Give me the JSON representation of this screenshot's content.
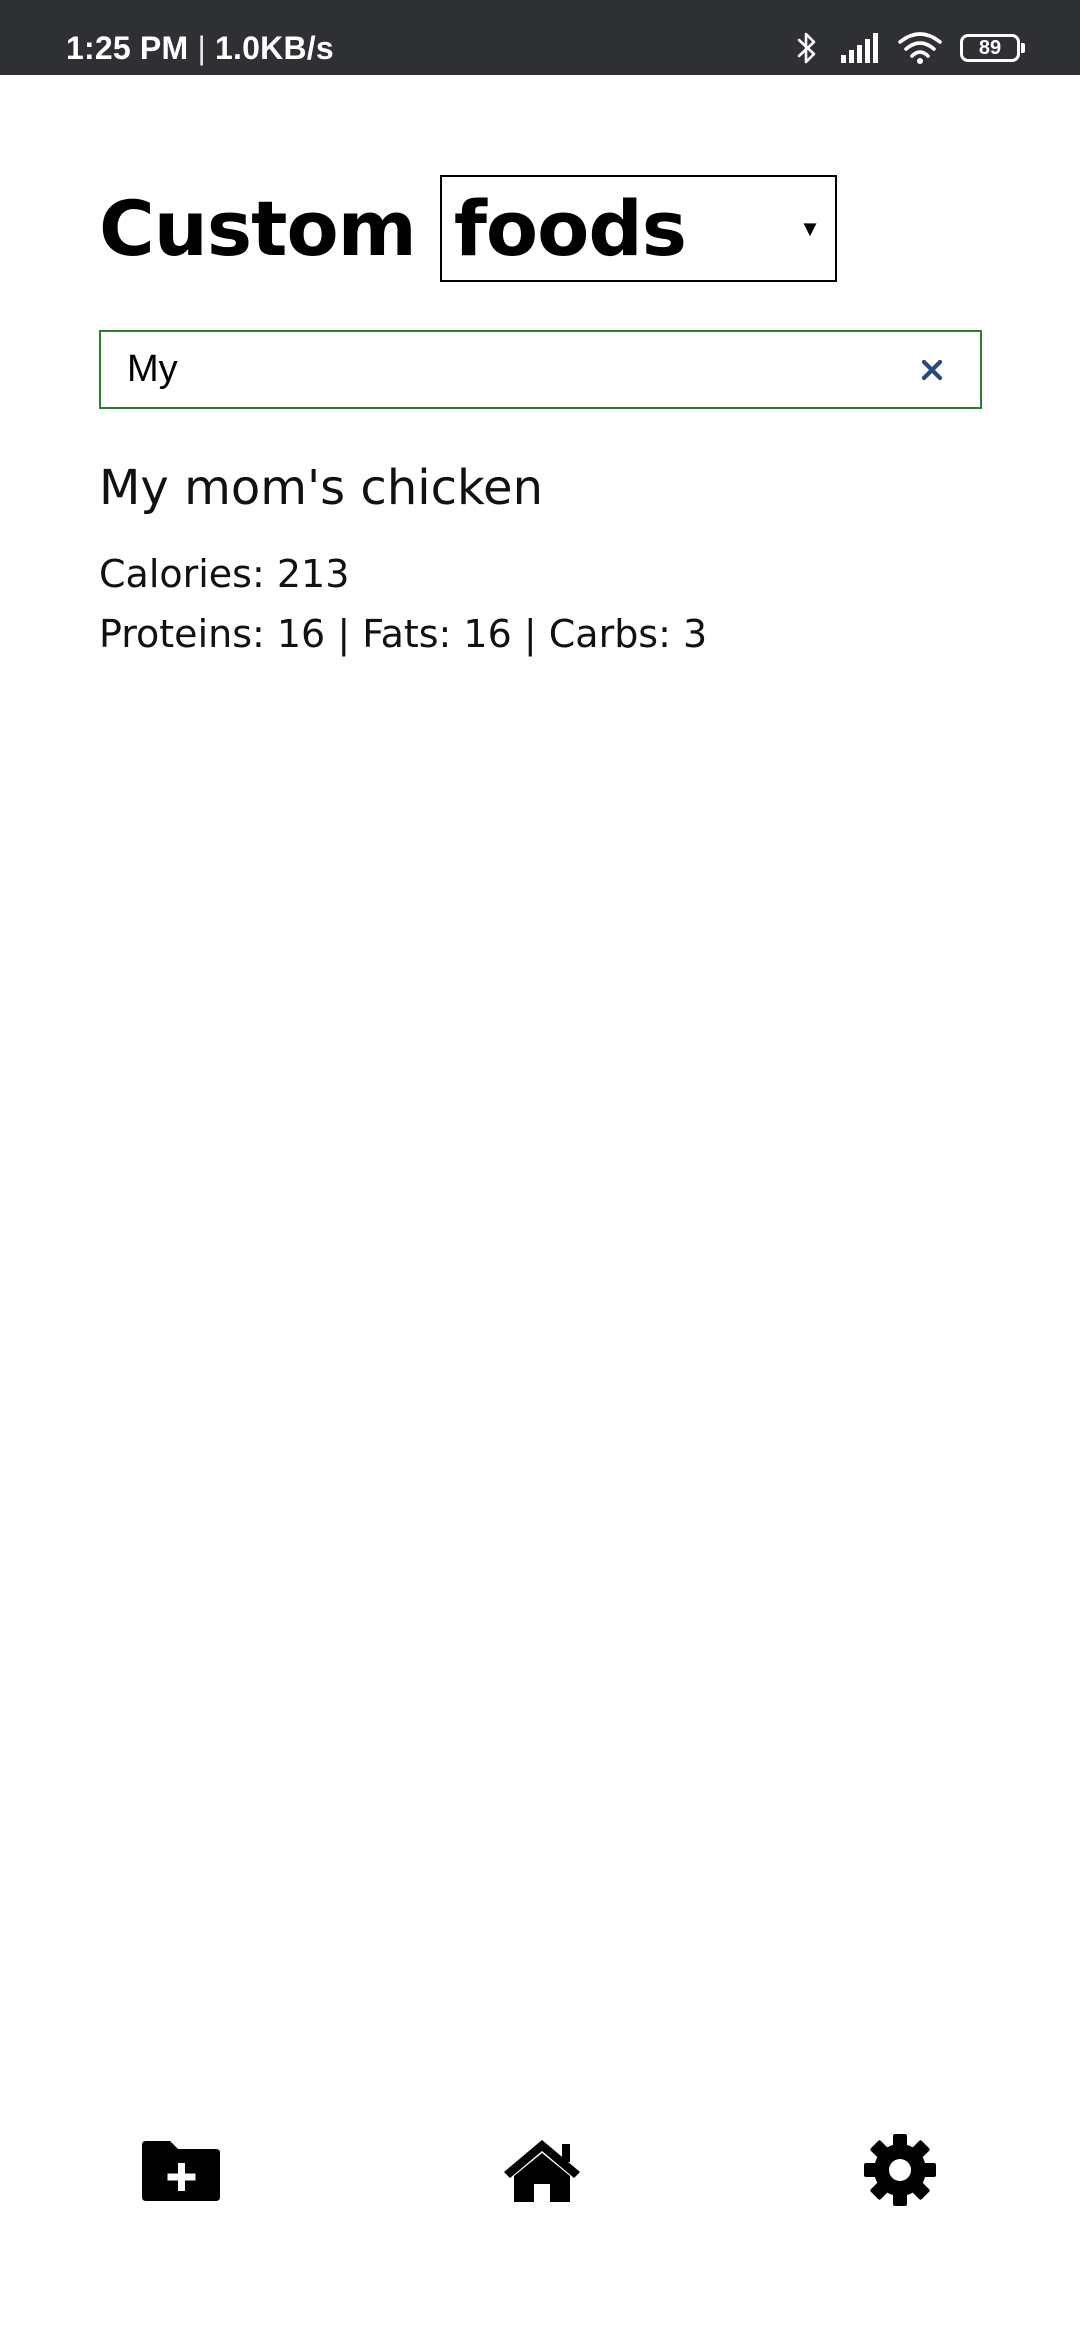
{
  "status_bar": {
    "time": "1:25 PM",
    "separator": "|",
    "network_speed": "1.0KB/s",
    "battery_level": "89",
    "icons": [
      "bluetooth-icon",
      "signal-icon",
      "wifi-icon",
      "battery-icon"
    ]
  },
  "header": {
    "title": "Custom",
    "category_selected": "foods"
  },
  "search": {
    "value": "My",
    "placeholder": "",
    "border_color": "#2e7d32",
    "clear_icon": "close-icon",
    "clear_icon_color": "#2b4a78"
  },
  "results": [
    {
      "name": "My mom's chicken",
      "calories_line": "Calories: 213",
      "macros_line": "Proteins: 16 | Fats: 16 | Carbs: 3"
    }
  ],
  "bottom_nav": {
    "items": [
      {
        "icon": "folder-plus-icon"
      },
      {
        "icon": "home-icon"
      },
      {
        "icon": "gear-icon"
      }
    ]
  }
}
